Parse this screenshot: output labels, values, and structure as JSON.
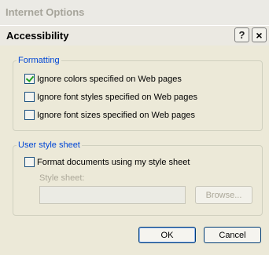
{
  "parent_window": {
    "title": "Internet Options"
  },
  "dialog": {
    "title": "Accessibility",
    "help_label": "?",
    "close_label": "×"
  },
  "formatting": {
    "legend": "Formatting",
    "options": [
      {
        "label": "Ignore colors specified on Web pages",
        "checked": true
      },
      {
        "label": "Ignore font styles specified on Web pages",
        "checked": false
      },
      {
        "label": "Ignore font sizes specified on Web pages",
        "checked": false
      }
    ]
  },
  "user_style_sheet": {
    "legend": "User style sheet",
    "format_label": "Format documents using my style sheet",
    "format_checked": false,
    "style_sheet_label": "Style sheet:",
    "style_sheet_value": "",
    "browse_label": "Browse..."
  },
  "buttons": {
    "ok": "OK",
    "cancel": "Cancel"
  },
  "colors": {
    "legend": "#0046D5",
    "check": "#21A121",
    "button_border": "#003C74"
  }
}
